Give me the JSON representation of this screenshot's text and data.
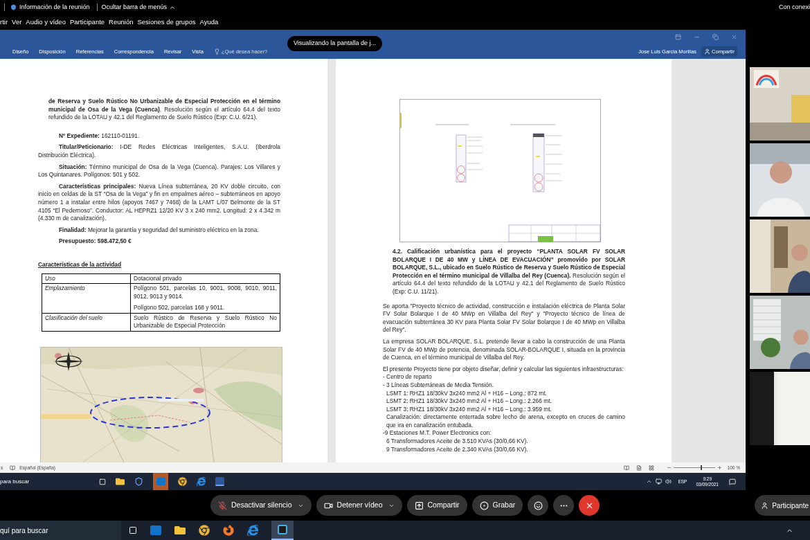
{
  "meeting_bar": {
    "info": "Información de la reunión",
    "hide_menu": "Ocultar barra de menús",
    "connection": "Con conexi"
  },
  "menu": [
    "rtir",
    "Ver",
    "Audio y vídeo",
    "Participante",
    "Reunión",
    "Sesiones de grupos",
    "Ayuda"
  ],
  "word": {
    "tabs": [
      "Diseño",
      "Disposición",
      "Referencias",
      "Correspondencia",
      "Revisar",
      "Vista"
    ],
    "search": "¿Qué desea hacer?",
    "user": "Jose Luis Garcia Morillas",
    "share": "Compartir"
  },
  "sharing_toast": "Visualizando la pantalla de j...",
  "doc_left": {
    "intro": "**de Reserva y Suelo Rústico No Urbanizable de Especial Protección en el término municipal de Osa de la Vega (Cuenca)**. Resolución según el artículo 64.4 del texto refundido de la LOTAU y 42.1 del Reglamento de Suelo Rústico (Exp: C.U. 6/21).",
    "fields": [
      "**Nº Expediente:** 162110-01191.",
      "**Titular/Peticionario:** I-DE Redes Eléctricas Inteligentes, S.A.U. (Iberdrola Distribución Eléctrica).",
      "**Situación:** Término municipal de Osa de la Vega (Cuenca). Parajes: Los Villares y Los Quintanares. Polígonos: 501 y 502.",
      "**Características principales:** Nueva Línea subterránea, 20 KV doble circuito, con inicio en celdas de la ST “Osa de la Vega” y fin en empalmes aéreo – subterráneos en apoyo número 1 a instalar entre hilos (apoyos 7467 y 7468) de la LAMT L/07 Belmonte de la ST 4105 “El Pedernoso”. Conductor: AL HEPRZ1 12/20 KV 3 x 240 mm2. Longitud: 2 x 4.342 m (4.330 m de canalización).",
      "**Finalidad:** Mejorar la garantía y seguridad del suministro eléctrico en la zona.",
      "**Presupuesto: 598.472,50 €**"
    ],
    "activity_title": "Características de la actividad",
    "activity_table": [
      {
        "label": "Uso",
        "values": [
          "Dotacional privado"
        ]
      },
      {
        "label": "Emplazamiento",
        "values": [
          "Polígono 501, parcelas 10, 9001, 9008, 9010, 9011, 9012, 9013 y 9014.",
          "Polígono 502, parcelas 168 y 9011."
        ]
      },
      {
        "label": "Clasificación del suelo",
        "values": [
          "Suelo Rústico de Reserva y Suelo Rústico No Urbanizable de Especial Protección"
        ]
      }
    ]
  },
  "doc_right": {
    "heading": "**4.2. Calificación urbanística para el proyecto “PLANTA SOLAR FV SOLAR BOLARQUE I DE 40 MW y LÍNEA DE EVACUACIÓN” promovido por SOLAR BOLARQUE, S.L., ubicado en Suelo Rústico de Reserva y Suelo Rústico de Especial Protección en el término municipal de Villalba del Rey (Cuenca).** Resolución según el artículo 64.4 del texto refundido de la LOTAU y 42.1 del Reglamento de Suelo Rústico (Exp: C.U. 11/21).",
    "paragraphs": [
      "Se aporta \"Proyecto técnico de actividad, construcción e instalación eléctrica de Planta Solar FV Solar Bolarque I de 40 MWp en Villalba del Rey\" y \"Proyecto técnico de línea de evacuación subterránea 30 KV para Planta Solar FV Solar Bolarque I de 40 MWp en Villalba del Rey\".",
      "La empresa SOLAR BOLARQUE, S.L. pretende llevar a cabo la construcción de una Planta Solar FV de 40 MWp de potencia, denominada SOLAR-BOLARQUE I, situada en la provincia de Cuenca, en el término municipal de Villalba del Rey.",
      "El presente Proyecto tiene por objeto diseñar, definir y calcular las siguientes infraestructuras:"
    ],
    "list": [
      {
        "kind": "top",
        "text": "- Centro de reparto"
      },
      {
        "kind": "top",
        "text": "- 3 Líneas Subterráneas de Media Tensión."
      },
      {
        "kind": "sub",
        "text": "LSMT 1: RHZ1 18/30kV 3x240 mm2 Al + H16 – Long.: 872 mt."
      },
      {
        "kind": "sub",
        "text": "LSMT 2: RHZ1 18/30kV 3x240 mm2 Al + H16 – Long.: 2.266 mt."
      },
      {
        "kind": "sub",
        "text": "LSMT 3: RHZ1 18/30kV 3x240 mm2 Al + H16 – Long.: 3.959 mt."
      },
      {
        "kind": "sub",
        "text": "Canalización: directamente enterrada sobre lecho de arena, excepto en cruces de camino que ira en canalización entubada."
      },
      {
        "kind": "top",
        "text": "-9 Estaciones M.T. Power Electronics con:"
      },
      {
        "kind": "sub",
        "text": "6 Transformadores Aceite de 3.510 KVAs (30/0,66 KV)."
      },
      {
        "kind": "sub",
        "text": "9 Transformadores Aceite de 2.340 KVAs (30/0,66 KV)."
      }
    ]
  },
  "status_bar": {
    "page": "s",
    "language": "Español (España)",
    "zoom": "100 %",
    "level": 0.65
  },
  "inner_taskbar": {
    "search": "para buscar",
    "language": "ESP",
    "time": "9:29",
    "date": "03/09/2021"
  },
  "controls": [
    {
      "kind": "mute",
      "label": "Desactivar silencio",
      "menu": true
    },
    {
      "kind": "video",
      "label": "Detener vídeo",
      "menu": true
    },
    {
      "kind": "share",
      "label": "Compartir",
      "menu": false
    },
    {
      "kind": "record",
      "label": "Grabar",
      "menu": false
    },
    {
      "kind": "reactions"
    },
    {
      "kind": "more"
    },
    {
      "kind": "end"
    }
  ],
  "participants_button": "Participante",
  "outer_taskbar": {
    "search": "quí para buscar"
  }
}
